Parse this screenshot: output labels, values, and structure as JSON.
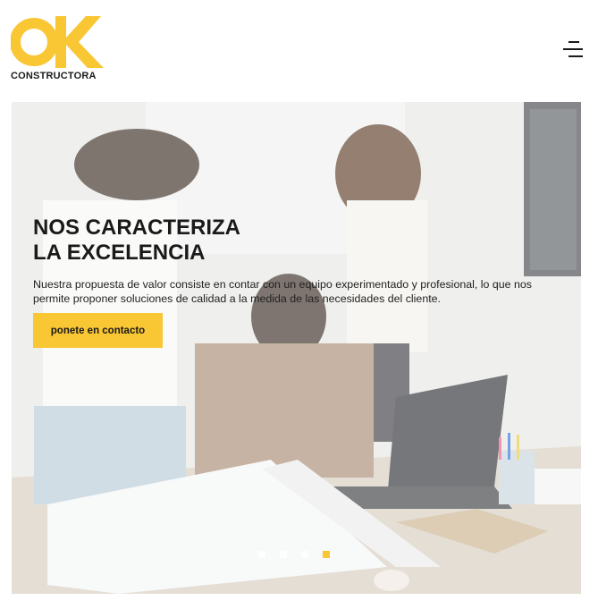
{
  "brand": {
    "logo_word": "CONSTRUCTORA",
    "accent_color": "#f9c634",
    "dark_color": "#1a1a1a"
  },
  "header": {
    "menu_icon": "hamburger-menu-icon"
  },
  "hero": {
    "title_line1": "NOS CARACTERIZA",
    "title_line2": "LA EXCELENCIA",
    "description": "Nuestra propuesta de valor consiste en contar con un equipo experimentado y profesional, lo que nos permite proponer soluciones de calidad a la medida de las necesidades del cliente.",
    "cta_label": "ponete en contacto",
    "slides_total": 4,
    "active_slide": 4
  }
}
